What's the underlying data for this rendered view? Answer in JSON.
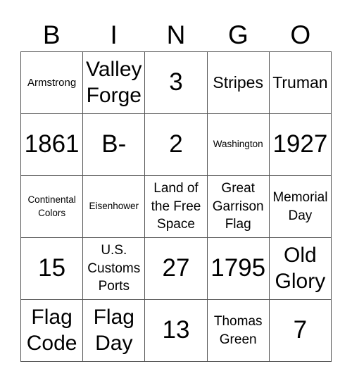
{
  "header": {
    "letters": [
      "B",
      "I",
      "N",
      "G",
      "O"
    ]
  },
  "card": {
    "cells": [
      [
        "Armstrong",
        "Valley Forge",
        "3",
        "Stripes",
        "Truman"
      ],
      [
        "1861",
        "B-",
        "2",
        "Washington",
        "1927"
      ],
      [
        "Continental Colors",
        "Eisenhower",
        "Land of the Free Space",
        "Great Garrison Flag",
        "Memorial Day"
      ],
      [
        "15",
        "U.S. Customs Ports",
        "27",
        "1795",
        "Old Glory"
      ],
      [
        "Flag Code",
        "Flag Day",
        "13",
        "Thomas Green",
        "7"
      ]
    ]
  },
  "colors": {
    "grid_line": "#555555",
    "text": "#000000",
    "background": "#ffffff"
  }
}
